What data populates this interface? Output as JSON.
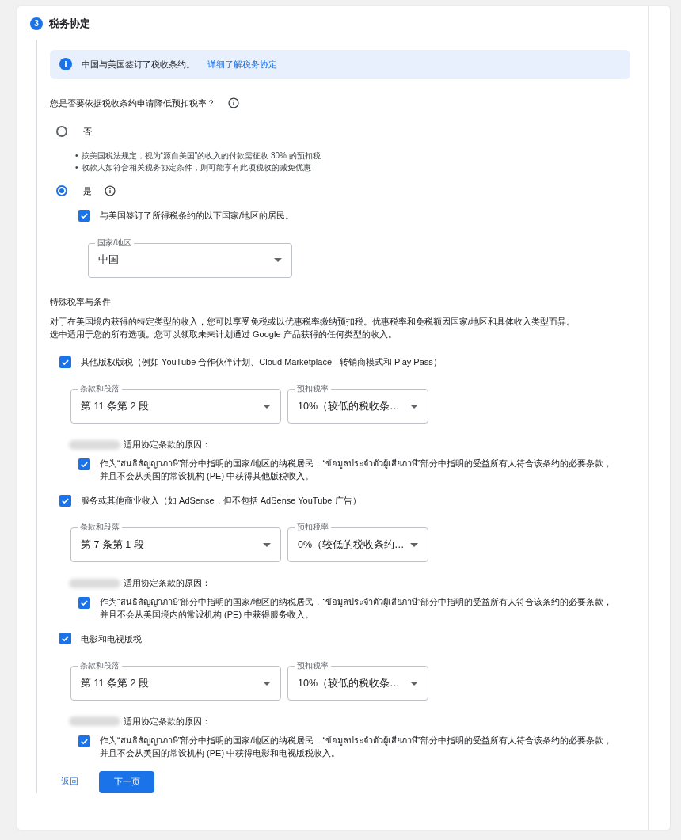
{
  "step": {
    "number": "3",
    "title": "税务协定"
  },
  "notice": {
    "text": "中国与美国签订了税收条约。",
    "link": "详细了解税务协定"
  },
  "question": "您是否要依据税收条约申请降低预扣税率？",
  "options": [
    {
      "label": "否",
      "selected": false,
      "bullets": [
        {
          "marker": "•",
          "text": "按美国税法规定，视为“源自美国”的收入的付款需征收 30% 的预扣税"
        },
        {
          "marker": "•",
          "text": "收款人如符合相关税务协定条件，则可能享有此项税收的减免优惠"
        }
      ]
    },
    {
      "label": "是",
      "selected": true,
      "info_icon": true
    }
  ],
  "residency": {
    "label": "与美国签订了所得税条约的以下国家/地区的居民。",
    "checked": true
  },
  "country": {
    "label": "国家/地区",
    "value": "中国"
  },
  "special": {
    "title": "特殊税率与条件",
    "description": [
      "对于在美国境内获得的特定类型的收入，您可以享受免税或以优惠税率缴纳预扣税。优惠税率和免税额因国家/地区和具体收入类型而异。",
      "选中适用于您的所有选项。您可以领取未来计划通过 Google 产品获得的任何类型的收入。"
    ]
  },
  "income_types": [
    {
      "label": "其他版权版税（例如 YouTube 合作伙伴计划、Cloud Marketplace - 转销商模式和 Play Pass）",
      "checked": true,
      "article": {
        "label": "条款和段落",
        "value": "第 11 条第 2 段"
      },
      "rate": {
        "label": "预扣税率",
        "value": "10%（较低的税收条…"
      },
      "reason_label": "适用协定条款的原因：",
      "reason": {
        "text": "作为“สนธิสัญญาภาษี”部分中指明的国家/地区的纳税居民，“ข้อมูลประจำตัวผู้เสียภาษี”部分中指明的受益所有人符合该条约的必要条款，并且不会从美国的常设机构 (PE) 中获得其他版税收入。",
        "checked": true
      }
    },
    {
      "label": "服务或其他商业收入（如 AdSense，但不包括 AdSense YouTube 广告）",
      "checked": true,
      "article": {
        "label": "条款和段落",
        "value": "第 7 条第 1 段"
      },
      "rate": {
        "label": "预扣税率",
        "value": "0%（较低的税收条约…"
      },
      "reason_label": "适用协定条款的原因：",
      "reason": {
        "text": "作为“สนธิสัญญาภาษี”部分中指明的国家/地区的纳税居民，“ข้อมูลประจำตัวผู้เสียภาษี”部分中指明的受益所有人符合该条约的必要条款，并且不会从美国境内的常设机构 (PE) 中获得服务收入。",
        "checked": true
      }
    },
    {
      "label": "电影和电视版税",
      "checked": true,
      "article": {
        "label": "条款和段落",
        "value": "第 11 条第 2 段"
      },
      "rate": {
        "label": "预扣税率",
        "value": "10%（较低的税收条…"
      },
      "reason_label": "适用协定条款的原因：",
      "reason": {
        "text": "作为“สนธิสัญญาภาษี”部分中指明的国家/地区的纳税居民，“ข้อมูลประจำตัวผู้เสียภาษี”部分中指明的受益所有人符合该条约的必要条款，并且不会从美国的常设机构 (PE) 中获得电影和电视版税收入。",
        "checked": true
      }
    }
  ],
  "buttons": {
    "back": "返回",
    "next": "下一页"
  }
}
